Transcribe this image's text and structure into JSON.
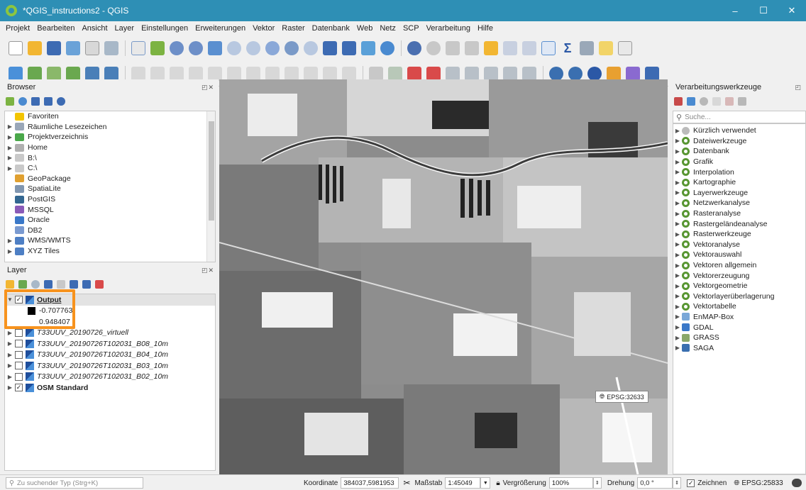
{
  "window": {
    "title": "*QGIS_instructions2 - QGIS",
    "controls": [
      "–",
      "☐",
      "✕"
    ]
  },
  "menu": [
    "Projekt",
    "Bearbeiten",
    "Ansicht",
    "Layer",
    "Einstellungen",
    "Erweiterungen",
    "Vektor",
    "Raster",
    "Datenbank",
    "Web",
    "Netz",
    "SCP",
    "Verarbeitung",
    "Hilfe"
  ],
  "toolbar": {
    "sigma_label": "Σ"
  },
  "browser": {
    "title": "Browser",
    "items": [
      {
        "label": "Favoriten",
        "expandable": false,
        "icon": "star-icon",
        "color": "#f2c400"
      },
      {
        "label": "Räumliche Lesezeichen",
        "expandable": true,
        "icon": "bookmark-icon",
        "color": "#9aa7b8"
      },
      {
        "label": "Projektverzeichnis",
        "expandable": true,
        "icon": "project-folder-icon",
        "color": "#4aa84a"
      },
      {
        "label": "Home",
        "expandable": true,
        "icon": "home-icon",
        "color": "#b0b0b0"
      },
      {
        "label": "B:\\",
        "expandable": true,
        "icon": "drive-icon",
        "color": "#c9c9c9"
      },
      {
        "label": "C:\\",
        "expandable": true,
        "icon": "drive-icon",
        "color": "#c9c9c9"
      },
      {
        "label": "GeoPackage",
        "expandable": false,
        "icon": "geopackage-icon",
        "color": "#e0a030"
      },
      {
        "label": "SpatiaLite",
        "expandable": false,
        "icon": "spatialite-icon",
        "color": "#8096b0"
      },
      {
        "label": "PostGIS",
        "expandable": false,
        "icon": "postgis-icon",
        "color": "#336791"
      },
      {
        "label": "MSSQL",
        "expandable": false,
        "icon": "mssql-icon",
        "color": "#8a5bb8"
      },
      {
        "label": "Oracle",
        "expandable": false,
        "icon": "oracle-icon",
        "color": "#3a78c8"
      },
      {
        "label": "DB2",
        "expandable": false,
        "icon": "db2-icon",
        "color": "#7a9ad0"
      },
      {
        "label": "WMS/WMTS",
        "expandable": true,
        "icon": "wms-icon",
        "color": "#4e7fc4"
      },
      {
        "label": "XYZ Tiles",
        "expandable": true,
        "icon": "xyz-tiles-icon",
        "color": "#4e7fc4"
      }
    ]
  },
  "layers": {
    "title": "Layer",
    "output": {
      "name": "Output",
      "min": "-0.707763",
      "max": "0.948407"
    },
    "items": [
      {
        "label": "T33UUV_20190726_virtuell",
        "checked": false,
        "italic": true,
        "bold": false
      },
      {
        "label": "T33UUV_20190726T102031_B08_10m",
        "checked": false,
        "italic": true,
        "bold": false
      },
      {
        "label": "T33UUV_20190726T102031_B04_10m",
        "checked": false,
        "italic": true,
        "bold": false
      },
      {
        "label": "T33UUV_20190726T102031_B03_10m",
        "checked": false,
        "italic": true,
        "bold": false
      },
      {
        "label": "T33UUV_20190726T102031_B02_10m",
        "checked": false,
        "italic": true,
        "bold": false
      },
      {
        "label": "OSM Standard",
        "checked": true,
        "italic": false,
        "bold": true
      }
    ],
    "highlight_color": "#f7931e"
  },
  "map": {
    "crs_popup": "EPSG:32633"
  },
  "processing": {
    "title": "Verarbeitungswerkzeuge",
    "search_placeholder": "Suche...",
    "items": [
      {
        "label": "Kürzlich verwendet",
        "icon": "clock-icon"
      },
      {
        "label": "Dateiwerkzeuge",
        "icon": "qgis-icon"
      },
      {
        "label": "Datenbank",
        "icon": "qgis-icon"
      },
      {
        "label": "Grafik",
        "icon": "qgis-icon"
      },
      {
        "label": "Interpolation",
        "icon": "qgis-icon"
      },
      {
        "label": "Kartographie",
        "icon": "qgis-icon"
      },
      {
        "label": "Layerwerkzeuge",
        "icon": "qgis-icon"
      },
      {
        "label": "Netzwerkanalyse",
        "icon": "qgis-icon"
      },
      {
        "label": "Rasteranalyse",
        "icon": "qgis-icon"
      },
      {
        "label": "Rastergeländeanalyse",
        "icon": "qgis-icon"
      },
      {
        "label": "Rasterwerkzeuge",
        "icon": "qgis-icon"
      },
      {
        "label": "Vektoranalyse",
        "icon": "qgis-icon"
      },
      {
        "label": "Vektorauswahl",
        "icon": "qgis-icon"
      },
      {
        "label": "Vektoren allgemein",
        "icon": "qgis-icon"
      },
      {
        "label": "Vektorerzeugung",
        "icon": "qgis-icon"
      },
      {
        "label": "Vektorgeometrie",
        "icon": "qgis-icon"
      },
      {
        "label": "Vektorlayerüberlagerung",
        "icon": "qgis-icon"
      },
      {
        "label": "Vektortabelle",
        "icon": "qgis-icon"
      },
      {
        "label": "EnMAP-Box",
        "icon": "enmap-icon"
      },
      {
        "label": "GDAL",
        "icon": "gdal-icon"
      },
      {
        "label": "GRASS",
        "icon": "grass-icon"
      },
      {
        "label": "SAGA",
        "icon": "saga-icon"
      }
    ]
  },
  "status": {
    "search_placeholder": "Zu suchender Typ (Strg+K)",
    "coord_label": "Koordinate",
    "coord_value": "384037,5981953",
    "scale_label": "Maßstab",
    "scale_value": "1:45049",
    "magnifier_label": "Vergrößerung",
    "magnifier_value": "100%",
    "rotation_label": "Drehung",
    "rotation_value": "0,0 °",
    "render_label": "Zeichnen",
    "crs": "EPSG:25833"
  }
}
